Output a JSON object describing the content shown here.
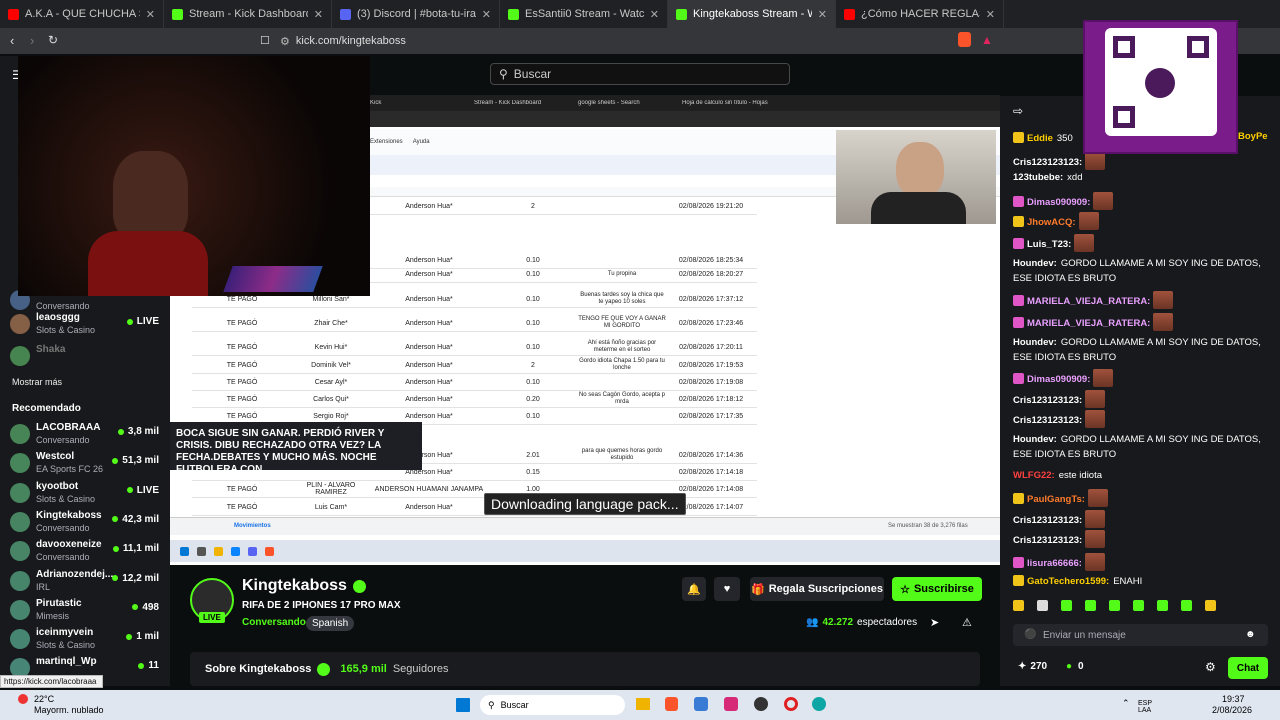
{
  "browser": {
    "tabs": [
      {
        "label": "A.K.A - QUE CHUCHA SALE? (Vídeo C",
        "color": "#ff0000"
      },
      {
        "label": "Stream - Kick Dashboard",
        "color": "#53fc18"
      },
      {
        "label": "(3) Discord | #bota-tu-ira",
        "color": "#5865f2"
      },
      {
        "label": "EsSantii0 Stream - Watch Live on Kick",
        "color": "#53fc18"
      },
      {
        "label": "Kingtekaboss Stream - Watch",
        "color": "#53fc18",
        "active": true
      },
      {
        "label": "¿Cómo HACER REGLAS para TU S",
        "color": "#ff0000"
      }
    ],
    "url": "kick.com/kingtekaboss"
  },
  "header": {
    "search_placeholder": "Buscar"
  },
  "sidebar": {
    "top_items": [
      {
        "name": "",
        "category": "Conversando"
      },
      {
        "name": "leaosggg",
        "category": "Slots & Casino",
        "viewers": "LIVE"
      },
      {
        "name": "Shaka",
        "category": ""
      }
    ],
    "more_label": "Mostrar más",
    "recommended_title": "Recomendado",
    "recommended": [
      {
        "name": "LACOBRAAA",
        "category": "Conversando",
        "viewers": "3,8 mil"
      },
      {
        "name": "Westcol",
        "category": "EA Sports FC 26",
        "viewers": "51,3 mil"
      },
      {
        "name": "kyootbot",
        "category": "Slots & Casino",
        "viewers": "LIVE"
      },
      {
        "name": "Kingtekaboss",
        "category": "Conversando",
        "viewers": "42,3 mil"
      },
      {
        "name": "davooxeneize",
        "category": "Conversando",
        "viewers": "11,1 mil"
      },
      {
        "name": "Adrianozendej...",
        "category": "IRL",
        "viewers": "12,2 mil"
      },
      {
        "name": "Pirutastic",
        "category": "Mimesis",
        "viewers": "498"
      },
      {
        "name": "iceinmyvein",
        "category": "Slots & Casino",
        "viewers": "1 mil"
      },
      {
        "name": "martinql_Wp",
        "category": "",
        "viewers": "11"
      }
    ],
    "status_url": "https://kick.com/lacobraaa"
  },
  "tooltip": {
    "text": "BOCA SIGUE SIN GANAR. PERDIÓ RIVER Y CRISIS. DIBU RECHAZADO OTRA VEZ? LA FECHA.DEBATES Y MUCHO MÁS. NOCHE FUTBOLERA CON..."
  },
  "video": {
    "inner_tabs": [
      "Kick",
      "Stream - Kick Dashboard",
      "google sheets - Search",
      "Hoja de cálculo sin título - Hojas"
    ],
    "menu": [
      "Extensiones",
      "Ayuda"
    ],
    "sheet_tab": "Movimientos",
    "sheet_rows": [
      {
        "a": "",
        "b": "",
        "c": "Anderson Hua*",
        "d": "2",
        "e": "",
        "f": "02/08/2026 19:21:20"
      },
      {
        "a": "",
        "b": "",
        "c": "Anderson Hua*",
        "d": "0.10",
        "e": "",
        "f": "02/08/2026 18:25:34"
      },
      {
        "a": "",
        "b": "",
        "c": "Anderson Hua*",
        "d": "0.10",
        "e": "Tu propina",
        "f": "02/08/2026 18:20:27"
      },
      {
        "a": "TE PAGÓ",
        "b": "Milloni San*",
        "c": "Anderson Hua*",
        "d": "0.10",
        "e": "Buenas tardes soy la chica que te yapeo 10 soles",
        "f": "02/08/2026 17:37:12"
      },
      {
        "a": "TE PAGÓ",
        "b": "Zhair Che*",
        "c": "Anderson Hua*",
        "d": "0.10",
        "e": "TENGO FE QUE VOY A GANAR MI GORDITO",
        "f": "02/08/2026 17:23:46"
      },
      {
        "a": "TE PAGÓ",
        "b": "Kevin Hui*",
        "c": "Anderson Hua*",
        "d": "0.10",
        "e": "Ahí está ñoño gracias por meterme en el sorteo",
        "f": "02/08/2026 17:20:11"
      },
      {
        "a": "TE PAGÓ",
        "b": "Dominik Vel*",
        "c": "Anderson Hua*",
        "d": "2",
        "e": "Gordo idiota Chapa 1.50 para tu lonche",
        "f": "02/08/2026 17:19:53"
      },
      {
        "a": "TE PAGÓ",
        "b": "Cesar Ayl*",
        "c": "Anderson Hua*",
        "d": "0.10",
        "e": "",
        "f": "02/08/2026 17:19:08"
      },
      {
        "a": "TE PAGÓ",
        "b": "Carlos Qui*",
        "c": "Anderson Hua*",
        "d": "0.20",
        "e": "No seas Cagón Gordo, acepta p mrda",
        "f": "02/08/2026 17:18:12"
      },
      {
        "a": "TE PAGÓ",
        "b": "Sergio Roj*",
        "c": "Anderson Hua*",
        "d": "0.10",
        "e": "",
        "f": "02/08/2026 17:17:35"
      },
      {
        "a": "",
        "b": "",
        "c": "Anderson Hua*",
        "d": "2.01",
        "e": "para que quemes horas gordo estupido",
        "f": "02/08/2026 17:14:36"
      },
      {
        "a": "",
        "b": "",
        "c": "Anderson Hua*",
        "d": "0.15",
        "e": "",
        "f": "02/08/2026 17:14:18"
      },
      {
        "a": "TE PAGÓ",
        "b": "PLIN - ALVARO RAMIREZ",
        "c": "ANDERSON HUAMANI JANAMPA",
        "d": "1.00",
        "e": "",
        "f": "02/08/2026 17:14:08"
      },
      {
        "a": "TE PAGÓ",
        "b": "Luis Cam*",
        "c": "Anderson Hua*",
        "d": "",
        "e": "",
        "f": "02/08/2026 17:14:07"
      }
    ],
    "footer_note": "Se muestran 38 de 3,276 filas",
    "toast": "Downloading language pack..."
  },
  "channel": {
    "name": "Kingtekaboss",
    "live_label": "LIVE",
    "title": "RIFA DE 2 IPHONES 17 PRO MAX",
    "category": "Conversando",
    "language": "Spanish",
    "gift_label": "Regala Suscripciones",
    "subscribe_label": "Suscribirse",
    "viewers": "42.272",
    "viewers_label": "espectadores",
    "about_label": "Sobre Kingtekaboss",
    "followers": "165,9 mil",
    "followers_label": "Seguidores"
  },
  "chat": {
    "messages": [
      {
        "user": "Eddie",
        "text": "350",
        "color": "#ffd000"
      },
      {
        "user": "Cris123123123:",
        "text": "",
        "color": "#ffffff",
        "emote": true
      },
      {
        "user": "123tubebe:",
        "text": "xdd",
        "color": "#ffffff"
      },
      {
        "user": "Dimas090909:",
        "text": "",
        "color": "#e9a0ff",
        "emote": true
      },
      {
        "user": "JhowACQ:",
        "text": "",
        "color": "#ff7b2c",
        "emote": true
      },
      {
        "user": "Luis_T23:",
        "text": "",
        "color": "#ffffff",
        "emote": true
      },
      {
        "user": "Houndev:",
        "text": "GORDO LLAMAME A MI SOY ING DE DATOS, ESE IDIOTA ES BRUTO",
        "color": "#ffffff"
      },
      {
        "user": "MARIELA_VIEJA_RATERA:",
        "text": "",
        "color": "#e9a0ff",
        "emote": true
      },
      {
        "user": "MARIELA_VIEJA_RATERA:",
        "text": "",
        "color": "#e9a0ff",
        "emote": true
      },
      {
        "user": "Houndev:",
        "text": "GORDO LLAMAME A MI SOY ING DE DATOS, ESE IDIOTA ES BRUTO",
        "color": "#ffffff"
      },
      {
        "user": "Dimas090909:",
        "text": "",
        "color": "#e9a0ff",
        "emote": true
      },
      {
        "user": "Cris123123123:",
        "text": "",
        "color": "#ffffff",
        "emote": true
      },
      {
        "user": "Cris123123123:",
        "text": "",
        "color": "#ffffff",
        "emote": true
      },
      {
        "user": "Houndev:",
        "text": "GORDO LLAMAME A MI SOY ING DE DATOS, ESE IDIOTA ES BRUTO",
        "color": "#ffffff"
      },
      {
        "user": "WLFG22:",
        "text": "este idiota",
        "color": "#ff4040"
      },
      {
        "user": "PaulGangTs:",
        "text": "",
        "color": "#ff7b2c",
        "emote": true
      },
      {
        "user": "Cris123123123:",
        "text": "",
        "color": "#ffffff",
        "emote": true
      },
      {
        "user": "Cris123123123:",
        "text": "",
        "color": "#ffffff",
        "emote": true
      },
      {
        "user": "lisura66666:",
        "text": "",
        "color": "#e9a0ff",
        "emote": true
      },
      {
        "user": "GatoTechero1599:",
        "text": "ENAHI",
        "color": "#ffd000"
      }
    ],
    "input_placeholder": "Enviar un mensaje",
    "points": "270",
    "kicks": "0",
    "chat_button": "Chat",
    "top_user_fragment": "BoyPe"
  },
  "taskbar": {
    "weather_temp": "22°C",
    "weather_desc": "Mayorm. nublado",
    "search_label": "Buscar",
    "lang": "ESP LAA",
    "time": "19:37",
    "date": "2/08/2026"
  }
}
